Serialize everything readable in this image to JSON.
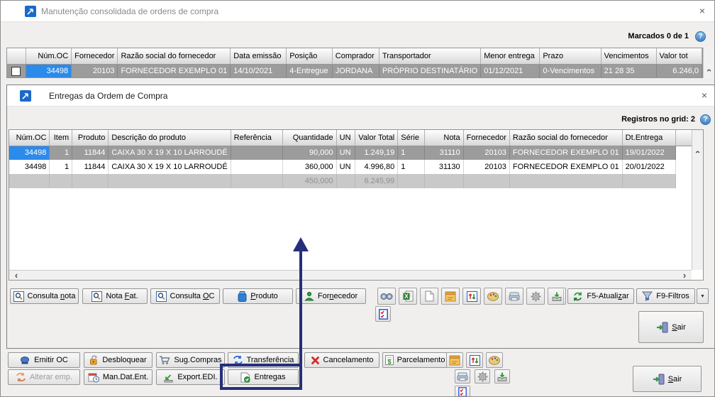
{
  "glyphs": {
    "close": "×",
    "help": "?",
    "scroll_left": "‹",
    "scroll_right": "›",
    "scroll_up": "‹",
    "dropdown": "▼"
  },
  "colors": {
    "selected_cell_blue": "#2b8aea",
    "selected_row_gray": "#9c9c9c",
    "annotation_navy": "#252f7a",
    "totals_gray": "#c9c9c9"
  },
  "bg_window": {
    "title": "Manutenção consolidada de ordens de compra",
    "marcados_label": "Marcados 0 de 1",
    "grid": {
      "columns": [
        "",
        "Núm.OC",
        "Fornecedor",
        "Razão social do fornecedor",
        "Data emissão",
        "Posição",
        "Comprador",
        "Transportador",
        "Menor entrega",
        "Prazo",
        "Vencimentos",
        "Valor tot"
      ],
      "row": [
        "34498",
        "20103",
        "FORNECEDOR EXEMPLO 01",
        "14/10/2021",
        "4-Entregue",
        "JORDANA",
        "PRÓPRIO DESTINATÁRIO",
        "01/12/2021",
        "0-Vencimentos",
        "21 28 35",
        "6.246,0"
      ]
    },
    "buttons_row1": [
      "Emitir OC",
      "Desbloquear",
      "Sug.Compras",
      "Transferência",
      "Cancelamento",
      "Parcelamento"
    ],
    "buttons_row2": [
      "Alterar emp.",
      "Man.Dat.Ent.",
      "Export.EDI.",
      "Entregas"
    ],
    "sair_button": {
      "pre": "",
      "key": "S",
      "post": "air"
    }
  },
  "fg_window": {
    "title": "Entregas da Ordem de Compra",
    "registros_label": "Registros no grid: 2",
    "grid": {
      "columns": [
        "Núm.OC",
        "Item",
        "Produto",
        "Descrição do produto",
        "Referência",
        "Quantidade",
        "UN",
        "Valor Total",
        "Série",
        "Nota",
        "Fornecedor",
        "Razão social do fornecedor",
        "Dt.Entrega"
      ],
      "rows": [
        [
          "34498",
          "1",
          "11844",
          "CAIXA 30 X 19 X 10 LARROUDÉ",
          "",
          "90,000",
          "UN",
          "1.249,19",
          "1",
          "31110",
          "20103",
          "FORNECEDOR EXEMPLO 01",
          "19/01/2022"
        ],
        [
          "34498",
          "1",
          "11844",
          "CAIXA 30 X 19 X 10 LARROUDÉ",
          "",
          "360,000",
          "UN",
          "4.996,80",
          "1",
          "31130",
          "20103",
          "FORNECEDOR EXEMPLO 01",
          "20/01/2022"
        ]
      ],
      "totals": {
        "quantidade": "450,000",
        "valor_total": "6.245,99"
      }
    },
    "buttons": [
      {
        "pre": "Consulta ",
        "key": "n",
        "post": "ota"
      },
      {
        "pre": "Nota ",
        "key": "F",
        "post": "at."
      },
      {
        "pre": "Consulta ",
        "key": "O",
        "post": "C"
      },
      {
        "pre": "",
        "key": "P",
        "post": "roduto"
      },
      {
        "pre": "For",
        "key": "n",
        "post": "ecedor"
      }
    ],
    "f5_button": {
      "pre": "F5-Atuali",
      "key": "z",
      "post": "ar"
    },
    "f9_button": {
      "pre": "F9-Filtros",
      "key": "",
      "post": ""
    },
    "sair_button": {
      "pre": "",
      "key": "S",
      "post": "air"
    }
  }
}
